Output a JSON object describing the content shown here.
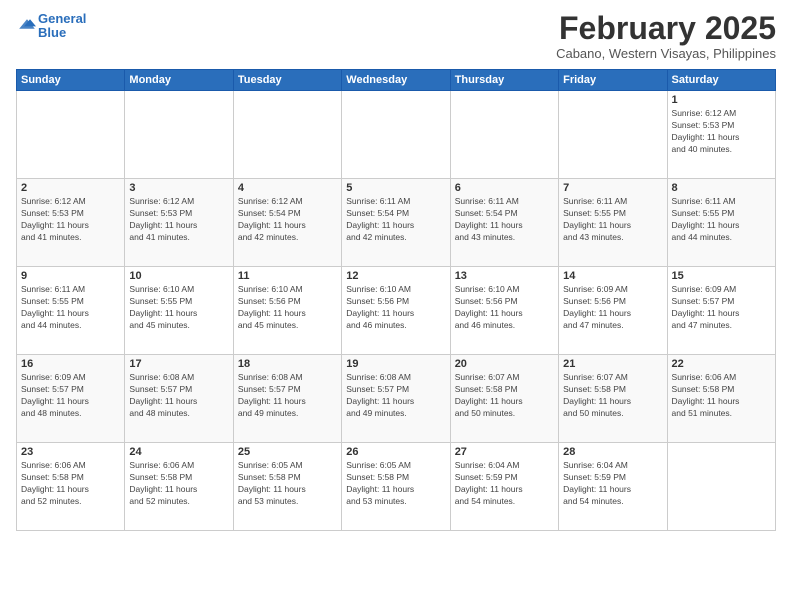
{
  "header": {
    "logo_line1": "General",
    "logo_line2": "Blue",
    "month_title": "February 2025",
    "subtitle": "Cabano, Western Visayas, Philippines"
  },
  "weekdays": [
    "Sunday",
    "Monday",
    "Tuesday",
    "Wednesday",
    "Thursday",
    "Friday",
    "Saturday"
  ],
  "weeks": [
    [
      {
        "day": "",
        "info": ""
      },
      {
        "day": "",
        "info": ""
      },
      {
        "day": "",
        "info": ""
      },
      {
        "day": "",
        "info": ""
      },
      {
        "day": "",
        "info": ""
      },
      {
        "day": "",
        "info": ""
      },
      {
        "day": "1",
        "info": "Sunrise: 6:12 AM\nSunset: 5:53 PM\nDaylight: 11 hours\nand 40 minutes."
      }
    ],
    [
      {
        "day": "2",
        "info": "Sunrise: 6:12 AM\nSunset: 5:53 PM\nDaylight: 11 hours\nand 41 minutes."
      },
      {
        "day": "3",
        "info": "Sunrise: 6:12 AM\nSunset: 5:53 PM\nDaylight: 11 hours\nand 41 minutes."
      },
      {
        "day": "4",
        "info": "Sunrise: 6:12 AM\nSunset: 5:54 PM\nDaylight: 11 hours\nand 42 minutes."
      },
      {
        "day": "5",
        "info": "Sunrise: 6:11 AM\nSunset: 5:54 PM\nDaylight: 11 hours\nand 42 minutes."
      },
      {
        "day": "6",
        "info": "Sunrise: 6:11 AM\nSunset: 5:54 PM\nDaylight: 11 hours\nand 43 minutes."
      },
      {
        "day": "7",
        "info": "Sunrise: 6:11 AM\nSunset: 5:55 PM\nDaylight: 11 hours\nand 43 minutes."
      },
      {
        "day": "8",
        "info": "Sunrise: 6:11 AM\nSunset: 5:55 PM\nDaylight: 11 hours\nand 44 minutes."
      }
    ],
    [
      {
        "day": "9",
        "info": "Sunrise: 6:11 AM\nSunset: 5:55 PM\nDaylight: 11 hours\nand 44 minutes."
      },
      {
        "day": "10",
        "info": "Sunrise: 6:10 AM\nSunset: 5:55 PM\nDaylight: 11 hours\nand 45 minutes."
      },
      {
        "day": "11",
        "info": "Sunrise: 6:10 AM\nSunset: 5:56 PM\nDaylight: 11 hours\nand 45 minutes."
      },
      {
        "day": "12",
        "info": "Sunrise: 6:10 AM\nSunset: 5:56 PM\nDaylight: 11 hours\nand 46 minutes."
      },
      {
        "day": "13",
        "info": "Sunrise: 6:10 AM\nSunset: 5:56 PM\nDaylight: 11 hours\nand 46 minutes."
      },
      {
        "day": "14",
        "info": "Sunrise: 6:09 AM\nSunset: 5:56 PM\nDaylight: 11 hours\nand 47 minutes."
      },
      {
        "day": "15",
        "info": "Sunrise: 6:09 AM\nSunset: 5:57 PM\nDaylight: 11 hours\nand 47 minutes."
      }
    ],
    [
      {
        "day": "16",
        "info": "Sunrise: 6:09 AM\nSunset: 5:57 PM\nDaylight: 11 hours\nand 48 minutes."
      },
      {
        "day": "17",
        "info": "Sunrise: 6:08 AM\nSunset: 5:57 PM\nDaylight: 11 hours\nand 48 minutes."
      },
      {
        "day": "18",
        "info": "Sunrise: 6:08 AM\nSunset: 5:57 PM\nDaylight: 11 hours\nand 49 minutes."
      },
      {
        "day": "19",
        "info": "Sunrise: 6:08 AM\nSunset: 5:57 PM\nDaylight: 11 hours\nand 49 minutes."
      },
      {
        "day": "20",
        "info": "Sunrise: 6:07 AM\nSunset: 5:58 PM\nDaylight: 11 hours\nand 50 minutes."
      },
      {
        "day": "21",
        "info": "Sunrise: 6:07 AM\nSunset: 5:58 PM\nDaylight: 11 hours\nand 50 minutes."
      },
      {
        "day": "22",
        "info": "Sunrise: 6:06 AM\nSunset: 5:58 PM\nDaylight: 11 hours\nand 51 minutes."
      }
    ],
    [
      {
        "day": "23",
        "info": "Sunrise: 6:06 AM\nSunset: 5:58 PM\nDaylight: 11 hours\nand 52 minutes."
      },
      {
        "day": "24",
        "info": "Sunrise: 6:06 AM\nSunset: 5:58 PM\nDaylight: 11 hours\nand 52 minutes."
      },
      {
        "day": "25",
        "info": "Sunrise: 6:05 AM\nSunset: 5:58 PM\nDaylight: 11 hours\nand 53 minutes."
      },
      {
        "day": "26",
        "info": "Sunrise: 6:05 AM\nSunset: 5:58 PM\nDaylight: 11 hours\nand 53 minutes."
      },
      {
        "day": "27",
        "info": "Sunrise: 6:04 AM\nSunset: 5:59 PM\nDaylight: 11 hours\nand 54 minutes."
      },
      {
        "day": "28",
        "info": "Sunrise: 6:04 AM\nSunset: 5:59 PM\nDaylight: 11 hours\nand 54 minutes."
      },
      {
        "day": "",
        "info": ""
      }
    ]
  ]
}
